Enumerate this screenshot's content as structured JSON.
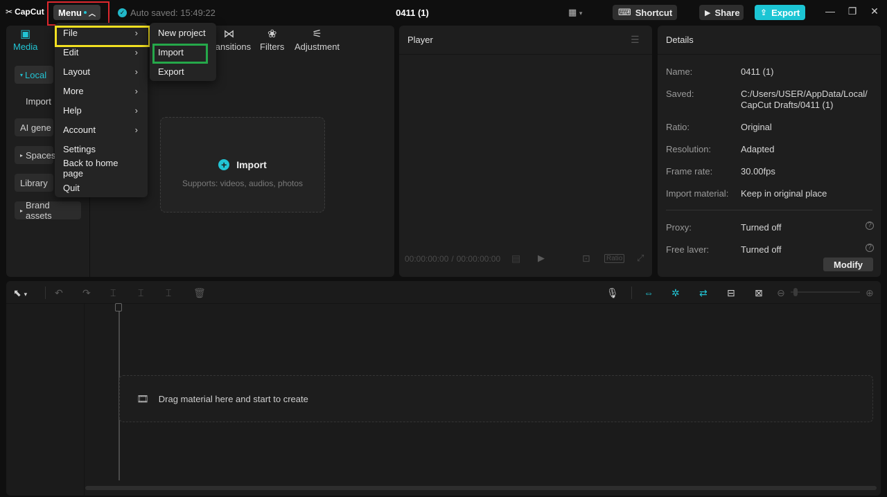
{
  "titlebar": {
    "logo": "CapCut",
    "menu_label": "Menu",
    "autosave": "Auto saved: 15:49:22",
    "project_title": "0411 (1)",
    "shortcut_label": "Shortcut",
    "share_label": "Share",
    "export_label": "Export"
  },
  "tabs": [
    {
      "label": "Media",
      "icon": "media-icon",
      "active": true
    },
    {
      "label": "Transitions",
      "icon": "transitions-icon"
    },
    {
      "label": "Filters",
      "icon": "filters-icon"
    },
    {
      "label": "Adjustment",
      "icon": "adjustment-icon"
    }
  ],
  "sidebar": {
    "items": [
      {
        "label": "Local",
        "active": true
      },
      {
        "label": "Import"
      },
      {
        "label": "AI gene"
      },
      {
        "label": "Spaces"
      },
      {
        "label": "Library"
      },
      {
        "label": "Brand assets"
      }
    ]
  },
  "import_card": {
    "title": "Import",
    "subtitle": "Supports: videos, audios, photos"
  },
  "menu": {
    "items": [
      {
        "label": "File",
        "submenu": true
      },
      {
        "label": "Edit",
        "submenu": true
      },
      {
        "label": "Layout",
        "submenu": true
      },
      {
        "label": "More",
        "submenu": true
      },
      {
        "label": "Help",
        "submenu": true
      },
      {
        "label": "Account",
        "submenu": true
      },
      {
        "label": "Settings"
      },
      {
        "label": "Back to home page"
      },
      {
        "label": "Quit"
      }
    ],
    "file_submenu": [
      {
        "label": "New project"
      },
      {
        "label": "Import"
      },
      {
        "label": "Export"
      }
    ]
  },
  "player": {
    "title": "Player",
    "current_time": "00:00:00:00",
    "total_time": "00:00:00:00",
    "ratio_label": "Ratio"
  },
  "details": {
    "title": "Details",
    "rows": [
      {
        "label": "Name:",
        "value": "0411 (1)"
      },
      {
        "label": "Saved:",
        "value": "C:/Users/USER/AppData/Local/CapCut Drafts/0411 (1)"
      },
      {
        "label": "Ratio:",
        "value": "Original"
      },
      {
        "label": "Resolution:",
        "value": "Adapted"
      },
      {
        "label": "Frame rate:",
        "value": "30.00fps"
      },
      {
        "label": "Import material:",
        "value": "Keep in original place"
      },
      {
        "label": "Proxy:",
        "value": "Turned off"
      },
      {
        "label": "Free layer:",
        "value": "Turned off"
      }
    ],
    "modify_label": "Modify"
  },
  "timeline": {
    "drop_text": "Drag material here and start to create"
  },
  "colors": {
    "accent": "#22c4d4",
    "highlight_red": "#e0282e",
    "highlight_yellow": "#f2e021",
    "highlight_green": "#25a84a"
  }
}
